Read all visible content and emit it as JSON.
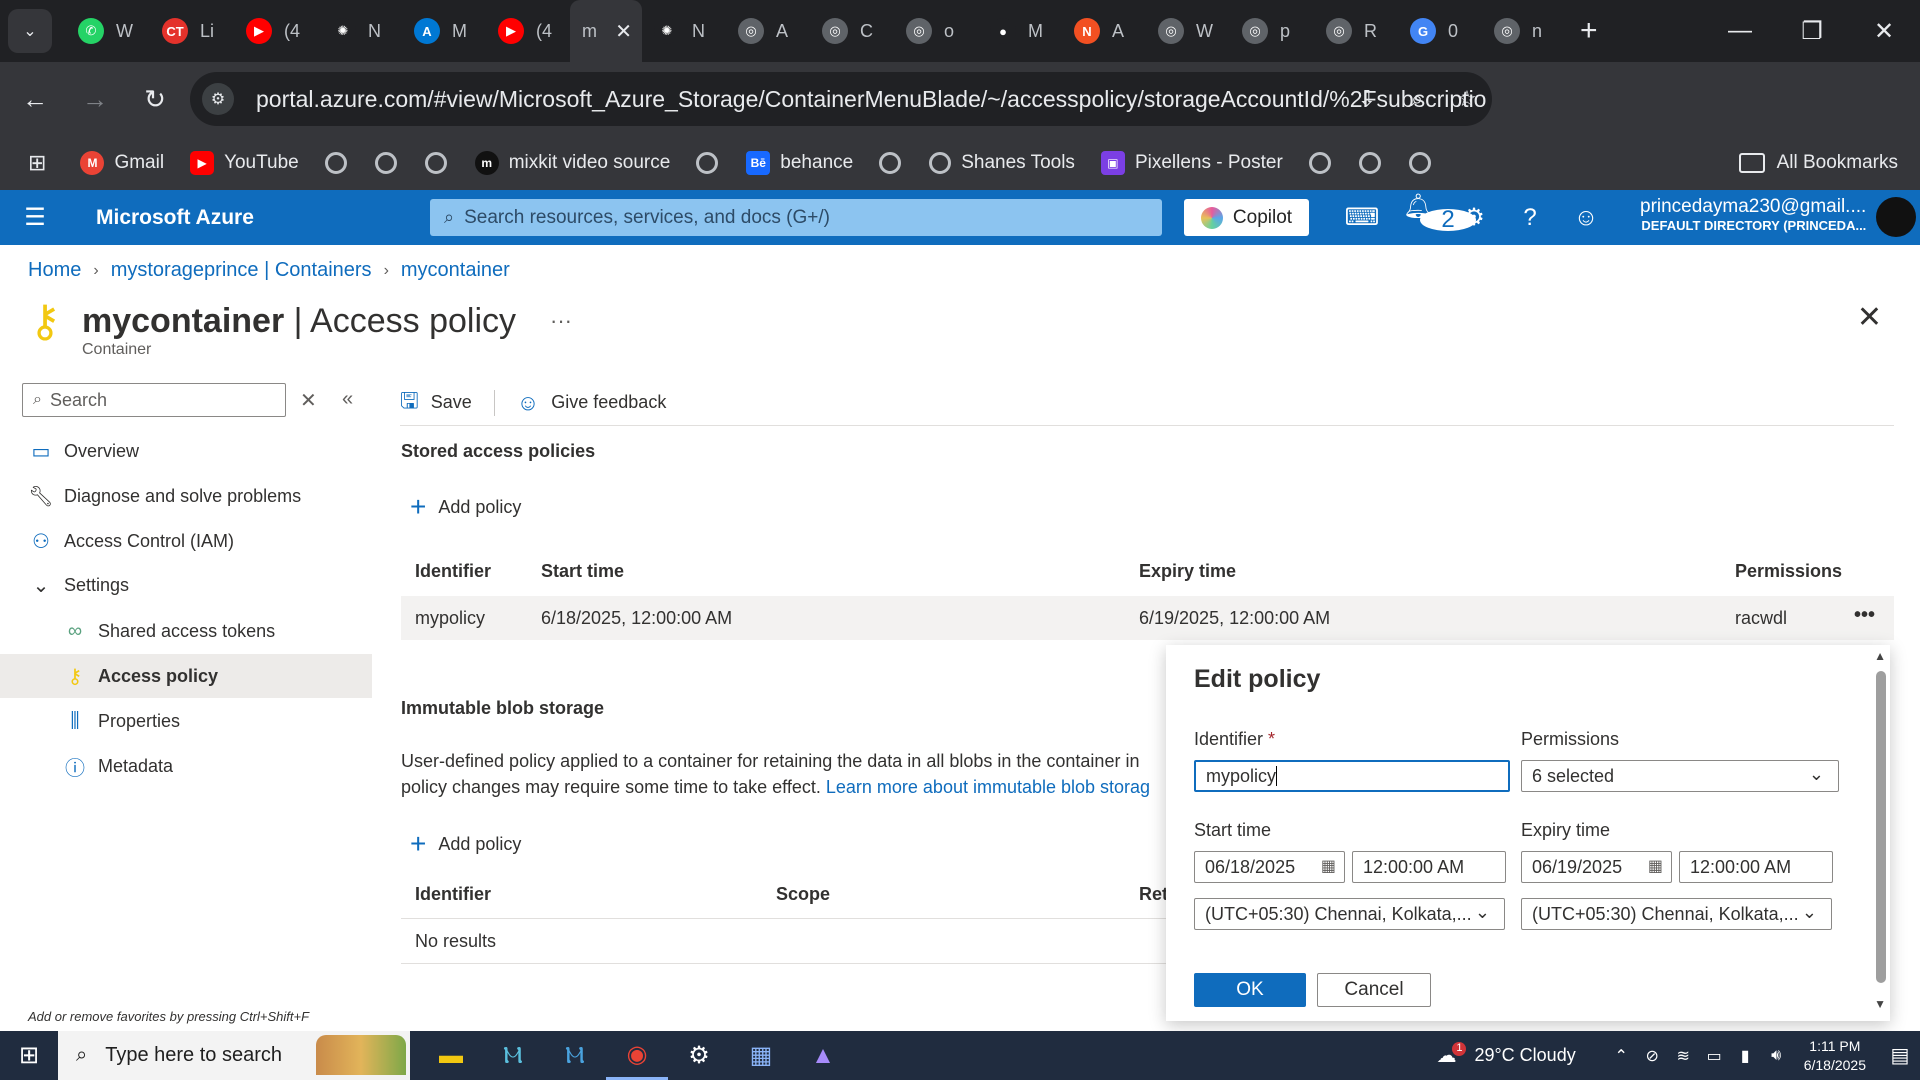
{
  "browser": {
    "tabs": [
      {
        "title": "W",
        "icon": "whatsapp-icon",
        "color": "#25d366",
        "glyph": "✆"
      },
      {
        "title": "Li",
        "icon": "ct-icon",
        "color": "#e4322b",
        "glyph": "CT"
      },
      {
        "title": "(4",
        "icon": "youtube-icon",
        "color": "#ff0000",
        "glyph": "▶"
      },
      {
        "title": "N",
        "icon": "openai-icon",
        "color": "#202124",
        "glyph": "✺"
      },
      {
        "title": "M",
        "icon": "azure-icon",
        "color": "#0078d4",
        "glyph": "A"
      },
      {
        "title": "(4",
        "icon": "youtube-icon",
        "color": "#ff0000",
        "glyph": "▶"
      },
      {
        "title": "m",
        "icon": "active-tab-icon",
        "color": "#35363a",
        "glyph": "",
        "active": true
      },
      {
        "title": "N",
        "icon": "openai-icon",
        "color": "#202124",
        "glyph": "✺"
      },
      {
        "title": "A",
        "icon": "globe-icon",
        "color": "#5f6368",
        "glyph": "◎"
      },
      {
        "title": "C",
        "icon": "globe-icon",
        "color": "#5f6368",
        "glyph": "◎"
      },
      {
        "title": "o",
        "icon": "globe-icon",
        "color": "#5f6368",
        "glyph": "◎"
      },
      {
        "title": "M",
        "icon": "github-icon",
        "color": "#202124",
        "glyph": "●"
      },
      {
        "title": "A",
        "icon": "app-icon",
        "color": "#f25022",
        "glyph": "N"
      },
      {
        "title": "W",
        "icon": "globe-icon",
        "color": "#5f6368",
        "glyph": "◎"
      },
      {
        "title": "p",
        "icon": "globe-icon",
        "color": "#5f6368",
        "glyph": "◎"
      },
      {
        "title": "R",
        "icon": "globe-icon",
        "color": "#5f6368",
        "glyph": "◎"
      },
      {
        "title": "0",
        "icon": "google-icon",
        "color": "#4285f4",
        "glyph": "G"
      },
      {
        "title": "n",
        "icon": "globe-icon",
        "color": "#5f6368",
        "glyph": "◎"
      }
    ],
    "url": "portal.azure.com/#view/Microsoft_Azure_Storage/ContainerMenuBlade/~/accesspolicy/storageAccountId/%2Fsubscriptions%...",
    "bookmarks": [
      {
        "label": "Gmail",
        "color": "#ea4335",
        "glyph": "M"
      },
      {
        "label": "YouTube",
        "color": "#ff0000",
        "glyph": "▶"
      },
      {
        "label": "mixkit video source",
        "color": "#111111",
        "glyph": "m"
      },
      {
        "label": "behance",
        "color": "#1769ff",
        "glyph": "Bē"
      },
      {
        "label": "Shanes Tools",
        "color": "#5f6368",
        "glyph": "◎"
      },
      {
        "label": "Pixellens - Poster",
        "color": "#7b3fe4",
        "glyph": "▣"
      }
    ],
    "all_bookmarks": "All Bookmarks"
  },
  "azure": {
    "brand": "Microsoft Azure",
    "search_placeholder": "Search resources, services, and docs (G+/)",
    "copilot": "Copilot",
    "notification_count": "2",
    "user_email": "princedayma230@gmail....",
    "user_directory": "DEFAULT DIRECTORY (PRINCEDA..."
  },
  "breadcrumb": [
    "Home",
    "mystorageprince | Containers",
    "mycontainer"
  ],
  "page": {
    "title_bold": "mycontainer",
    "title_rest": " | Access policy",
    "more": "···",
    "subtitle": "Container"
  },
  "nav": {
    "search_placeholder": "Search",
    "items": [
      {
        "label": "Overview"
      },
      {
        "label": "Diagnose and solve problems"
      },
      {
        "label": "Access Control (IAM)"
      },
      {
        "label": "Settings"
      },
      {
        "label": "Shared access tokens"
      },
      {
        "label": "Access policy"
      },
      {
        "label": "Properties"
      },
      {
        "label": "Metadata"
      }
    ]
  },
  "toolbar": {
    "save": "Save",
    "feedback": "Give feedback"
  },
  "stored": {
    "title": "Stored access policies",
    "add": "Add policy",
    "columns": [
      "Identifier",
      "Start time",
      "Expiry time",
      "Permissions"
    ],
    "rows": [
      {
        "identifier": "mypolicy",
        "start": "6/18/2025, 12:00:00 AM",
        "expiry": "6/19/2025, 12:00:00 AM",
        "permissions": "racwdl",
        "more": "•••"
      }
    ]
  },
  "immutable": {
    "title": "Immutable blob storage",
    "desc_line1": "User-defined policy applied to a container for retaining the data in all blobs in the container in",
    "desc_line2": "policy changes may require some time to take effect. ",
    "learn_more": "Learn more about immutable blob storag",
    "add": "Add policy",
    "columns": [
      "Identifier",
      "Scope",
      "Ret"
    ],
    "empty": "No results"
  },
  "edit_policy": {
    "title": "Edit policy",
    "identifier_label": "Identifier",
    "required": " *",
    "identifier_value": "mypolicy",
    "permissions_label": "Permissions",
    "permissions_value": "6 selected",
    "start_label": "Start time",
    "start_date": "06/18/2025",
    "start_time": "12:00:00 AM",
    "start_tz": "(UTC+05:30) Chennai, Kolkata,...",
    "expiry_label": "Expiry time",
    "expiry_date": "06/19/2025",
    "expiry_time": "12:00:00 AM",
    "expiry_tz": "(UTC+05:30) Chennai, Kolkata,...",
    "ok": "OK",
    "cancel": "Cancel"
  },
  "favorites_hint": "Add or remove favorites by pressing Ctrl+Shift+F",
  "taskbar": {
    "search_placeholder": "Type here to search",
    "weather": "29°C  Cloudy",
    "time": "1:11 PM",
    "date": "6/18/2025",
    "weather_badge": "1"
  }
}
